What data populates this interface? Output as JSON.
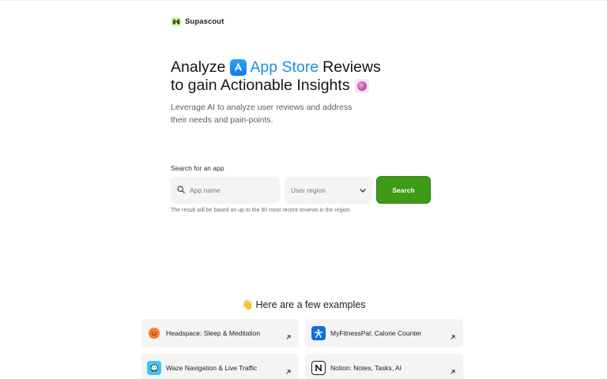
{
  "brand": {
    "name": "Supascout",
    "icon": "binoculars-icon"
  },
  "hero": {
    "line1_prefix": "Analyze",
    "line1_accent": "App Store",
    "line1_suffix": "Reviews",
    "line2": "to gain Actionable Insights",
    "accent_color": "#1d8fe8"
  },
  "subtitle": "Leverage AI to analyze user reviews and address their needs and pain-points.",
  "search": {
    "label": "Search for an app",
    "app_placeholder": "App name",
    "region_placeholder": "User region",
    "button_label": "Search",
    "button_color": "#3f9a15",
    "hint": "The result will be based on up to the 50 most recent reviews in the region"
  },
  "examples": {
    "wave_emoji": "👋",
    "title": "Here are a few examples",
    "items": [
      {
        "label": "Headspace: Sleep & Meditation",
        "icon": "headspace-icon",
        "color": "#f47d31"
      },
      {
        "label": "MyFitnessPal: Calorie Counter",
        "icon": "myfitnesspal-icon",
        "color": "#0f6de0"
      },
      {
        "label": "Waze Navigation & Live Traffic",
        "icon": "waze-icon",
        "color": "#3ec6f0"
      },
      {
        "label": "Notion: Notes, Tasks, AI",
        "icon": "notion-icon",
        "color": "#111111"
      }
    ]
  }
}
